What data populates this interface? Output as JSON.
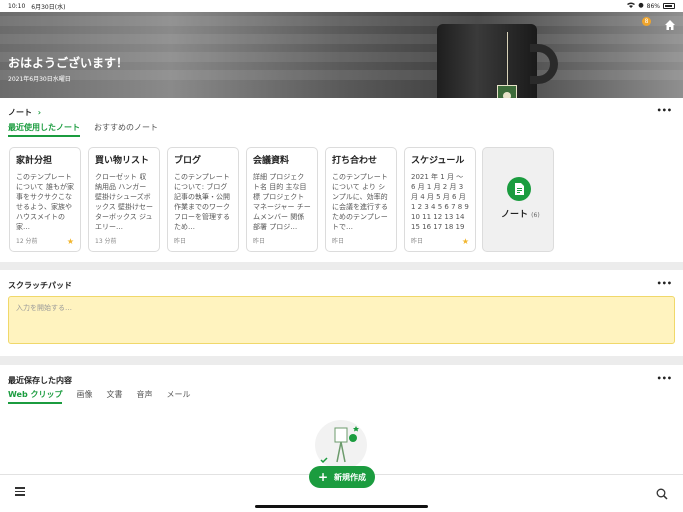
{
  "status": {
    "time": "10:10",
    "date": "6月30日(水)",
    "battery": "86%"
  },
  "hero": {
    "greeting": "おはようございます！",
    "date": "2021年6月30日水曜日",
    "coin": "8"
  },
  "notes": {
    "title": "ノート",
    "chevron": "›",
    "tabs": [
      {
        "label": "最近使用したノート"
      },
      {
        "label": "おすすめのノート"
      }
    ],
    "cards": [
      {
        "title": "家計分担",
        "body": "このテンプレートについて 誰もが家事をサクサクこなせるよう、家族やハウスメイトの家…",
        "time": "12 分前",
        "starred": true
      },
      {
        "title": "買い物リスト",
        "body": "クローゼット 収納用品 ハンガー 壁掛けシューズボックス 壁掛けセーターボックス ジュエリー…",
        "time": "13 分前",
        "starred": false
      },
      {
        "title": "ブログ",
        "body": "このテンプレートについて: ブログ記事の執筆・公開作業までのワークフローを管理するため…",
        "time": "昨日",
        "starred": false
      },
      {
        "title": "会議資料",
        "body": "詳細 プロジェクト名 目的 主な目標 プロジェクトマネージャー チームメンバー 関係部署 プロジ…",
        "time": "昨日",
        "starred": false
      },
      {
        "title": "打ち合わせ",
        "body": "このテンプレートについて より シンプルに、効率的に会議を進行するためのテンプレートで…",
        "time": "昨日",
        "starred": false
      },
      {
        "title": "スケジュール",
        "body": "2021 年 1 月 ～ 6 月 1 月 2 月 3 月 4 月 5 月 6 月 1 2 3 4 5 6 7 8 9 10 11 12 13 14 15 16 17 18 19 20 21 22 2…",
        "time": "昨日",
        "starred": true
      }
    ],
    "tile": {
      "label": "ノート",
      "count": "(6)"
    }
  },
  "scratchpad": {
    "title": "スクラッチパッド",
    "placeholder": "入力を開始する…"
  },
  "recent": {
    "title": "最近保存した内容",
    "tabs": [
      {
        "label": "Web クリップ"
      },
      {
        "label": "画像"
      },
      {
        "label": "文書"
      },
      {
        "label": "音声"
      },
      {
        "label": "メール"
      }
    ]
  },
  "new_button": {
    "label": "新規作成",
    "color": "#1b9c3f"
  },
  "more": "•••"
}
